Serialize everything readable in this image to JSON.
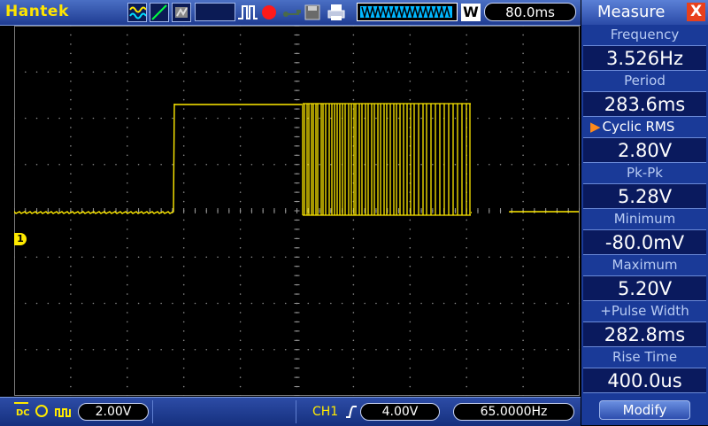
{
  "topbar": {
    "brand": "Hantek",
    "timebase": "80.0ms",
    "zoom_label": "W"
  },
  "measure": {
    "title": "Measure",
    "close_label": "X",
    "items": [
      {
        "label": "Frequency",
        "value": "3.526Hz"
      },
      {
        "label": "Period",
        "value": "283.6ms"
      },
      {
        "label": "Cyclic RMS",
        "value": "2.80V",
        "active": true
      },
      {
        "label": "Pk-Pk",
        "value": "5.28V"
      },
      {
        "label": "Minimum",
        "value": "-80.0mV"
      },
      {
        "label": "Maximum",
        "value": "5.20V"
      },
      {
        "label": "+Pulse Width",
        "value": "282.8ms"
      },
      {
        "label": "Rise Time",
        "value": "400.0us"
      }
    ],
    "modify_label": "Modify"
  },
  "channel": {
    "marker": "1",
    "volts_div": "2.00V",
    "trigger_channel": "CH1",
    "trigger_level": "4.00V",
    "frequency_counter": "65.0000Hz"
  },
  "colors": {
    "trace": "#ffea00",
    "panel": "#1a3a98",
    "bar": "#2d4ca6"
  }
}
